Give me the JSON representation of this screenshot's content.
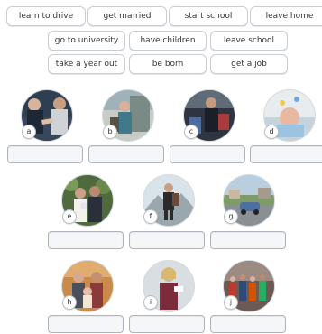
{
  "word_bank": [
    "learn to drive",
    "get married",
    "start school",
    "leave home",
    "go to university",
    "have children",
    "leave school",
    "take a year out",
    "be born",
    "get a job"
  ],
  "photos": [
    {
      "letter": "a",
      "icon": "handshake-photo"
    },
    {
      "letter": "b",
      "icon": "student-photo"
    },
    {
      "letter": "c",
      "icon": "luggage-photo"
    },
    {
      "letter": "d",
      "icon": "baby-photo"
    },
    {
      "letter": "e",
      "icon": "wedding-photo"
    },
    {
      "letter": "f",
      "icon": "hiker-photo"
    },
    {
      "letter": "g",
      "icon": "car-photo"
    },
    {
      "letter": "h",
      "icon": "family-photo"
    },
    {
      "letter": "i",
      "icon": "graduate-photo"
    },
    {
      "letter": "j",
      "icon": "schoolchildren-photo"
    }
  ]
}
